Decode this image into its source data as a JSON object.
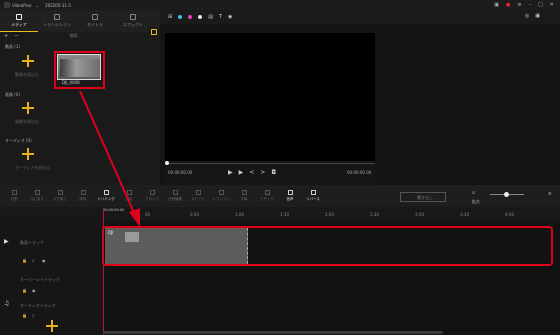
{
  "titlebar": {
    "app_name": "VideoProc",
    "project_name": "202205-11-5",
    "icons": [
      "logo-icon",
      "dropdown-icon",
      "save-icon",
      "menu-icon",
      "minimize-icon",
      "maximize-icon",
      "close-icon"
    ]
  },
  "media_panel": {
    "tabs": [
      {
        "label": "メディア",
        "icon": "media-icon",
        "active": true
      },
      {
        "label": "トランジション",
        "icon": "transition-icon",
        "active": false
      },
      {
        "label": "タイトル",
        "icon": "title-icon",
        "active": false
      },
      {
        "label": "エフェクト",
        "icon": "effect-icon",
        "active": false
      }
    ],
    "toolbar": {
      "add": "+",
      "remove": "−",
      "search_placeholder": "検索..."
    },
    "sections": [
      {
        "label": "動画 (1)",
        "hint": "動画を読込む"
      },
      {
        "label": "画像 (0)",
        "hint": "画像を読込む"
      },
      {
        "label": "オーディオ (0)",
        "hint": "オーディオを読込む"
      }
    ],
    "clip": {
      "name": "DJI_0008"
    }
  },
  "preview": {
    "timecode_current": "00:00:00.00",
    "timecode_total": "00:00:00.00",
    "colors": {
      "dot1": "#2ec4e0",
      "dot2": "#e040b0",
      "dot3": "#e8e8e8"
    }
  },
  "toolbar": {
    "tools": [
      "分割",
      "元に戻す",
      "やり直し",
      "削除",
      "トリミング",
      "回転",
      "クロップ",
      "分割編集",
      "スピード",
      "エフェクト",
      "字幕",
      "モザイク",
      "音声",
      "リバース"
    ],
    "export_label": "書き出し",
    "zoom_label": "拡大"
  },
  "timeline": {
    "playhead_time": "00:00:00.00",
    "ticks": [
      "00",
      "0:30",
      "1:00",
      "1:30",
      "2:00",
      "2:30",
      "3:00",
      "3:30",
      "4:00"
    ],
    "tracks": [
      {
        "label": "動画トラック",
        "icon": "video-track-icon"
      },
      {
        "label": "オーバーレイトラック",
        "icon": "overlay-track-icon"
      },
      {
        "label": "オーディオトラック",
        "icon": "audio-track-icon"
      }
    ],
    "clip_label": "DJI"
  },
  "accent_colors": {
    "highlight": "#e0001b",
    "brand": "#e8b020"
  }
}
